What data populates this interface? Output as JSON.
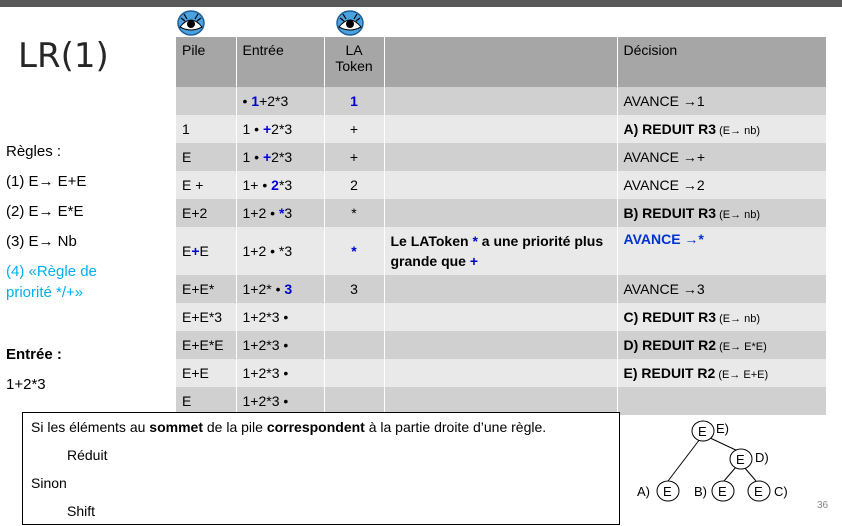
{
  "slide": {
    "title": "LR(1)",
    "page_number": "36"
  },
  "rules": {
    "heading": "Règles :",
    "r1": "(1) E→ E+E",
    "r2": "(2) E→ E*E",
    "r3": "(3) E→ Nb",
    "r4a": "(4) «Règle de",
    "r4b": "priorité */+»",
    "input_heading": "Entrée :",
    "input_value": "1+2*3"
  },
  "table": {
    "headers": [
      "Pile",
      "Entrée",
      "LA\nToken",
      "",
      "Décision"
    ],
    "header_la_line1": "LA",
    "header_la_line2": "Token",
    "rows": [
      {
        "pile": "",
        "entree_pre": "• ",
        "entree_hl": "1",
        "entree_post": "+2*3",
        "la": "1",
        "note": "",
        "decision": "AVANCE   →1"
      },
      {
        "pile": "1",
        "entree_pre": "1 • ",
        "entree_hl": "+",
        "entree_post": "2*3",
        "la": "+",
        "note": "",
        "dec_bold": "A) REDUIT R3",
        "dec_small": " (E→ nb)"
      },
      {
        "pile": "E",
        "entree_pre": "1 • ",
        "entree_hl": "+",
        "entree_post": "2*3",
        "la": "+",
        "note": "",
        "decision": "AVANCE   →+"
      },
      {
        "pile": "E +",
        "entree_pre": "1+ • ",
        "entree_hl": "2",
        "entree_post": "*3",
        "la": "2",
        "note": "",
        "decision": "AVANCE   →2"
      },
      {
        "pile": "E+2",
        "entree_pre": "1+2 • ",
        "entree_hl": "*",
        "entree_post": "3",
        "la": "*",
        "note": "",
        "dec_bold": "B) REDUIT R3",
        "dec_small": " (E→ nb)"
      },
      {
        "pile_pre": "E",
        "pile_hl": "+",
        "pile_post": "E",
        "entree": "1+2 • *3",
        "la": "*",
        "note_pre": "Le LAToken ",
        "note_hl1": "*",
        "note_mid": " a une priorité plus grande que ",
        "note_hl2": "+",
        "decision": "AVANCE   →*"
      },
      {
        "pile": "E+E*",
        "entree_pre": "1+2* • ",
        "entree_hl": "3",
        "entree_post": "",
        "la": "3",
        "note": "",
        "decision": "AVANCE   →3"
      },
      {
        "pile": "E+E*3",
        "entree": "1+2*3 •",
        "la": "",
        "note": "",
        "dec_bold": "C) REDUIT R3",
        "dec_small": " (E→ nb)"
      },
      {
        "pile": "E+E*E",
        "entree": "1+2*3 •",
        "la": "",
        "note": "",
        "dec_bold": "D) REDUIT R2",
        "dec_small": " (E→ E*E)"
      },
      {
        "pile": "E+E",
        "entree": "1+2*3 •",
        "la": "",
        "note": "",
        "dec_bold": "E) REDUIT R2",
        "dec_small": " (E→ E+E)"
      },
      {
        "pile": "E",
        "entree": "1+2*3 •",
        "la": "",
        "note": "",
        "decision": ""
      }
    ]
  },
  "note_box": {
    "line1_a": "Si les éléments au ",
    "line1_b": "sommet",
    "line1_c": " de la pile ",
    "line1_d": "correspondent",
    "line1_e": " à la partie droite d’une règle.",
    "line2": "Réduit",
    "line3": "Sinon",
    "line4": "Shift"
  },
  "tree": {
    "node": "E",
    "lab_E": "E)",
    "lab_D": "D)",
    "lab_A": "A)",
    "lab_B": "B)",
    "lab_C": "C)"
  },
  "colors": {
    "accent_blue": "#00b0f0",
    "token_blue": "#0000cc",
    "header_gray": "#a6a6a6"
  }
}
